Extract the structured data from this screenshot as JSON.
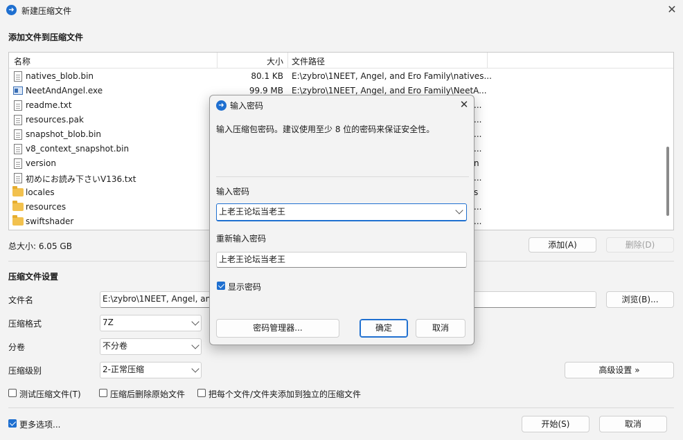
{
  "window": {
    "title": "新建压缩文件",
    "icon": "app-logo-icon"
  },
  "add_section": {
    "title": "添加文件到压缩文件",
    "columns": [
      "名称",
      "大小",
      "文件路径"
    ],
    "files": [
      {
        "name": "natives_blob.bin",
        "size": "80.1 KB",
        "path": "E:\\zybro\\1NEET, Angel, and Ero Family\\natives...",
        "icon": "file-icon",
        "path_tail": ""
      },
      {
        "name": "NeetAndAngel.exe",
        "size": "99.9 MB",
        "path": "E:\\zybro\\1NEET, Angel, and Ero Family\\NeetA...",
        "icon": "exe-icon",
        "path_tail": ""
      },
      {
        "name": "readme.txt",
        "size": "",
        "path": "",
        "icon": "file-icon",
        "path_tail": "..."
      },
      {
        "name": "resources.pak",
        "size": "",
        "path": "",
        "icon": "file-icon",
        "path_tail": "..."
      },
      {
        "name": "snapshot_blob.bin",
        "size": "",
        "path": "",
        "icon": "file-icon",
        "path_tail": "..."
      },
      {
        "name": "v8_context_snapshot.bin",
        "size": "",
        "path": "",
        "icon": "file-icon",
        "path_tail": "..."
      },
      {
        "name": "version",
        "size": "",
        "path": "",
        "icon": "file-icon",
        "path_tail": "n"
      },
      {
        "name": "初めにお読み下さいV136.txt",
        "size": "",
        "path": "",
        "icon": "file-icon",
        "path_tail": "..."
      },
      {
        "name": "locales",
        "size": "",
        "path": "",
        "icon": "folder-icon",
        "path_tail": "s"
      },
      {
        "name": "resources",
        "size": "",
        "path": "",
        "icon": "folder-icon",
        "path_tail": "..."
      },
      {
        "name": "swiftshader",
        "size": "",
        "path": "",
        "icon": "folder-icon",
        "path_tail": "..."
      }
    ],
    "total_size": "总大小: 6.05 GB",
    "add_button": "添加(A)",
    "delete_button": "删除(D)"
  },
  "settings": {
    "title": "压缩文件设置",
    "filename_label": "文件名",
    "filename_value": "E:\\zybro\\1NEET, Angel, and",
    "browse_button": "浏览(B)...",
    "format_label": "压缩格式",
    "format_value": "7Z",
    "volume_label": "分卷",
    "volume_value": "不分卷",
    "level_label": "压缩级别",
    "level_value": "2-正常压缩",
    "advanced_button": "高级设置 »",
    "test_checkbox": "测试压缩文件(T)",
    "delete_after_checkbox": "压缩后删除原始文件",
    "separate_checkbox": "把每个文件/文件夹添加到独立的压缩文件",
    "more_options": "更多选项...",
    "more_options_checked": true,
    "start_button": "开始(S)",
    "cancel_button": "取消"
  },
  "dialog": {
    "title": "输入密码",
    "description": "输入压缩包密码。建议使用至少 8 位的密码来保证安全性。",
    "password_label": "输入密码",
    "password_value": "上老王论坛当老王",
    "confirm_label": "重新输入密码",
    "confirm_value": "上老王论坛当老王",
    "show_password": "显示密码",
    "show_password_checked": true,
    "manager_button": "密码管理器...",
    "ok_button": "确定",
    "cancel_button": "取消"
  },
  "colors": {
    "accent": "#1e6fd0",
    "background": "#f3f3f3"
  }
}
